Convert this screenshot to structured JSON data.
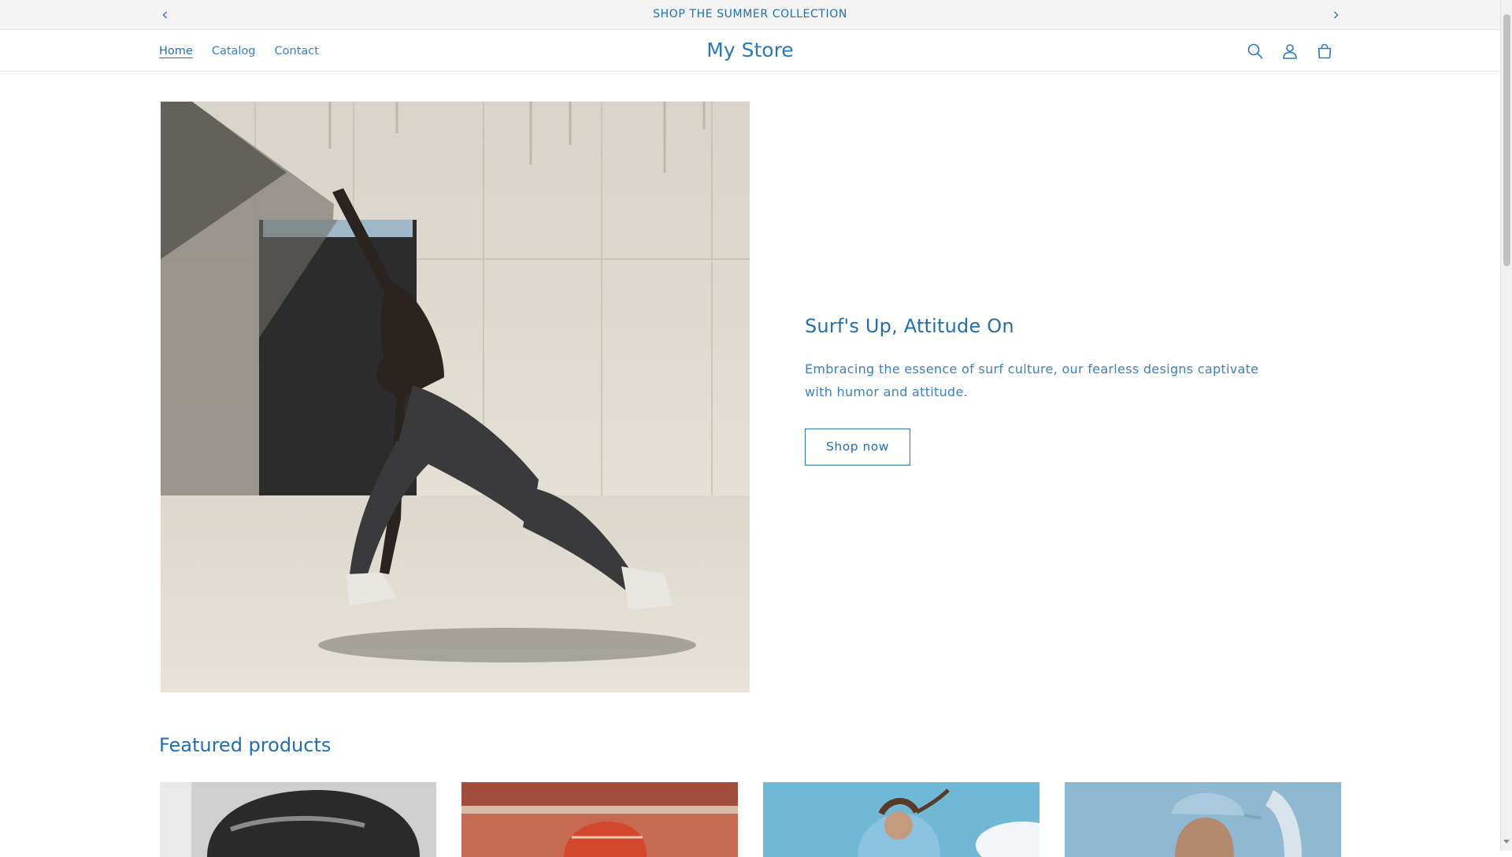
{
  "announcement": {
    "text": "SHOP THE SUMMER COLLECTION",
    "prev_icon": "chevron-left-icon",
    "next_icon": "chevron-right-icon"
  },
  "header": {
    "nav": [
      {
        "label": "Home",
        "active": true
      },
      {
        "label": "Catalog",
        "active": false
      },
      {
        "label": "Contact",
        "active": false
      }
    ],
    "logo": "My Store",
    "icons": [
      "search-icon",
      "account-icon",
      "cart-icon"
    ]
  },
  "hero": {
    "heading": "Surf's Up, Attitude On",
    "text": "Embracing the essence of surf culture, our fearless designs captivate with humor and attitude.",
    "button_label": "Shop now"
  },
  "featured": {
    "title": "Featured products",
    "products": [
      {
        "image": "product-image-monochrome-portrait"
      },
      {
        "image": "product-image-red-cap"
      },
      {
        "image": "product-image-sky-portrait"
      },
      {
        "image": "product-image-blue-cap-portrait"
      }
    ]
  },
  "colors": {
    "accent": "#1f6fb2",
    "announcement_bg": "#f3f3f3",
    "border": "#e6e6e6"
  }
}
